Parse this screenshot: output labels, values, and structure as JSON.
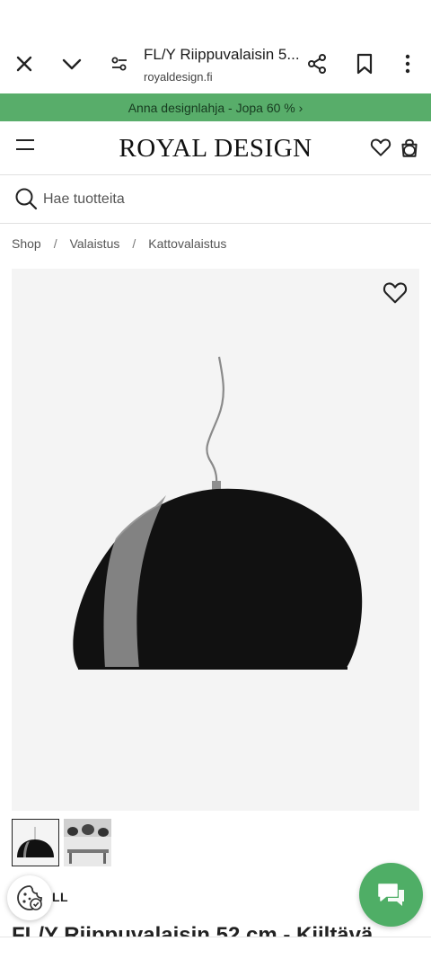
{
  "browser": {
    "title": "FL/Y Riippuvalaisin 5...",
    "url": "royaldesign.fi",
    "icons": [
      "close-icon",
      "chevron-down-icon",
      "page-settings-icon",
      "share-icon",
      "bookmark-icon",
      "more-vert-icon"
    ]
  },
  "promo": {
    "text": "Anna designlahja - Jopa 60 % ›"
  },
  "header": {
    "logo": "ROYAL DESIGN",
    "icons": [
      "menu-icon",
      "heart-icon",
      "bag-icon"
    ]
  },
  "search": {
    "placeholder": "Hae tuotteita"
  },
  "breadcrumb": {
    "items": [
      "Shop",
      "Valaistus",
      "Kattovalaistus"
    ],
    "separator": "/"
  },
  "product": {
    "brand": "LL",
    "title": "FL/Y Riippuvalaisin 52 cm - Kiiltävä",
    "image_alt": "black-pendant-lamp"
  },
  "colors": {
    "promo_bg": "#58ad6a",
    "chat_bg": "#4fae66",
    "image_bg": "#f4f4f4"
  }
}
